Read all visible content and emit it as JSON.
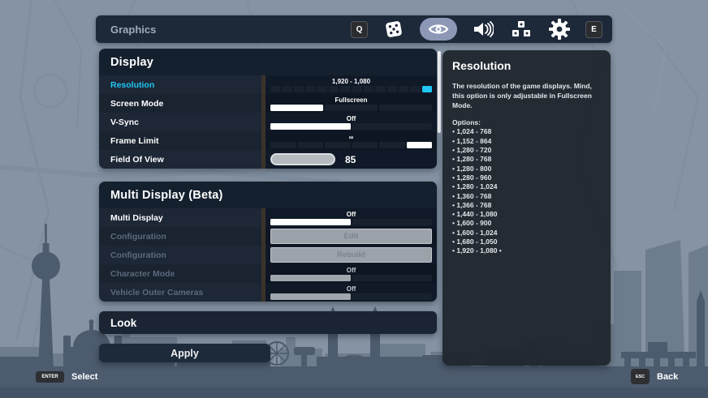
{
  "titlebar": {
    "title": "Graphics",
    "key_prev": "Q",
    "key_next": "E",
    "icons": [
      "dice-icon",
      "eye-icon",
      "speaker-icon",
      "blocks-icon",
      "gear-icon"
    ],
    "selected_icon": "eye-icon"
  },
  "display": {
    "title": "Display",
    "rows": [
      {
        "label": "Resolution",
        "value": "1,920 - 1,080",
        "bar": {
          "count": 14,
          "selected": 13,
          "selected_color": "#1fc7f4"
        }
      },
      {
        "label": "Screen Mode",
        "value": "Fullscreen",
        "bar": {
          "count": 3,
          "selected": 0,
          "selected_color": "#ffffff"
        }
      },
      {
        "label": "V-Sync",
        "value": "Off",
        "bar": {
          "count": 2,
          "selected": 0,
          "selected_color": "#ffffff"
        }
      },
      {
        "label": "Frame Limit",
        "value": "∞",
        "bar": {
          "count": 6,
          "selected": 5,
          "selected_color": "#ffffff"
        }
      },
      {
        "label": "Field Of View",
        "value": "85"
      }
    ]
  },
  "multi_display": {
    "title": "Multi Display (Beta)",
    "rows": [
      {
        "label": "Multi Display",
        "value": "Off",
        "bar": {
          "count": 2,
          "selected": 0,
          "selected_color": "#ffffff"
        }
      },
      {
        "label": "Configuration",
        "button": "Edit"
      },
      {
        "label": "Configuration",
        "button": "Rebuild"
      },
      {
        "label": "Character Mode",
        "value": "Off",
        "bar": {
          "count": 2,
          "selected": 0,
          "selected_color": "#9fa6ad"
        }
      },
      {
        "label": "Vehicle Outer Cameras",
        "value": "Off",
        "bar": {
          "count": 2,
          "selected": 0,
          "selected_color": "#9fa6ad"
        }
      }
    ]
  },
  "look": {
    "title": "Look"
  },
  "apply": {
    "label": "Apply"
  },
  "info_panel": {
    "title": "Resolution",
    "description": "The resolution of the game displays. Mind, this option is only adjustable in Fullscreen Mode.",
    "options_label": "Options:",
    "options": [
      "• 1,024 - 768",
      "• 1,152 - 864",
      "• 1,280 - 720",
      "• 1,280 - 768",
      "• 1,280 - 800",
      "• 1,280 - 960",
      "• 1,280 - 1,024",
      "• 1,360 - 768",
      "• 1,366 - 768",
      "• 1,440 - 1,080",
      "• 1,600 - 900",
      "• 1,600 - 1,024",
      "• 1,680 - 1,050",
      "• 1,920 - 1,080 •"
    ]
  },
  "footer": {
    "select_key": "ENTER",
    "select_label": "Select",
    "back_key": "ESC",
    "back_label": "Back"
  },
  "colors": {
    "accent_cyan": "#1fc7f4",
    "selected_tab_bg": "#8d97b6",
    "panel_navy": "#1d2939"
  }
}
